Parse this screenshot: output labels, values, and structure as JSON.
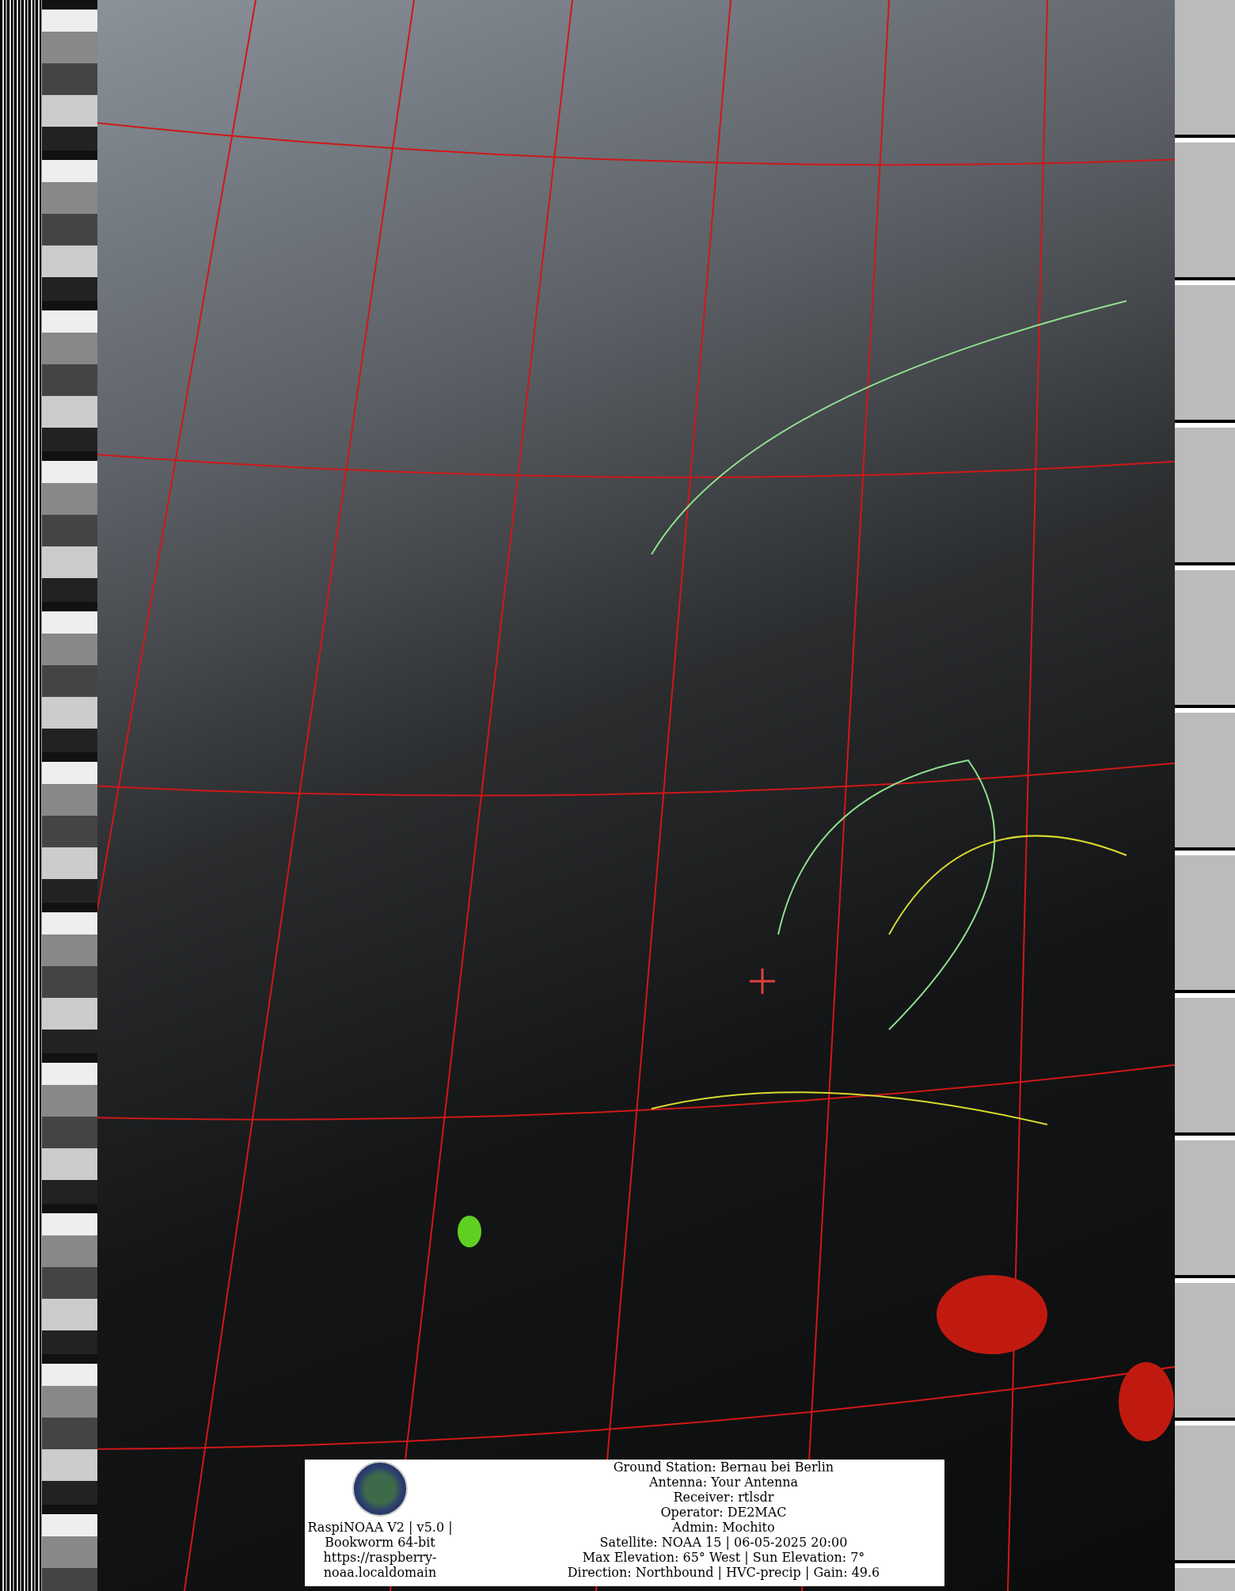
{
  "info_panel": {
    "software_lines": [
      "RaspiNOAA V2 | v5.0 |",
      "Bookworm 64-bit",
      "https://raspberry-",
      "noaa.localdomain"
    ],
    "station_lines": [
      "Ground Station: Bernau bei Berlin",
      "Antenna: Your Antenna",
      "Receiver: rtlsdr",
      "Operator: DE2MAC",
      "Admin: Mochito",
      "Satellite: NOAA 15 | 06-05-2025 20:00",
      "Max Elevation: 65° West | Sun Elevation: 7°",
      "Direction: Northbound | HVC-precip | Gain: 49.6"
    ]
  }
}
